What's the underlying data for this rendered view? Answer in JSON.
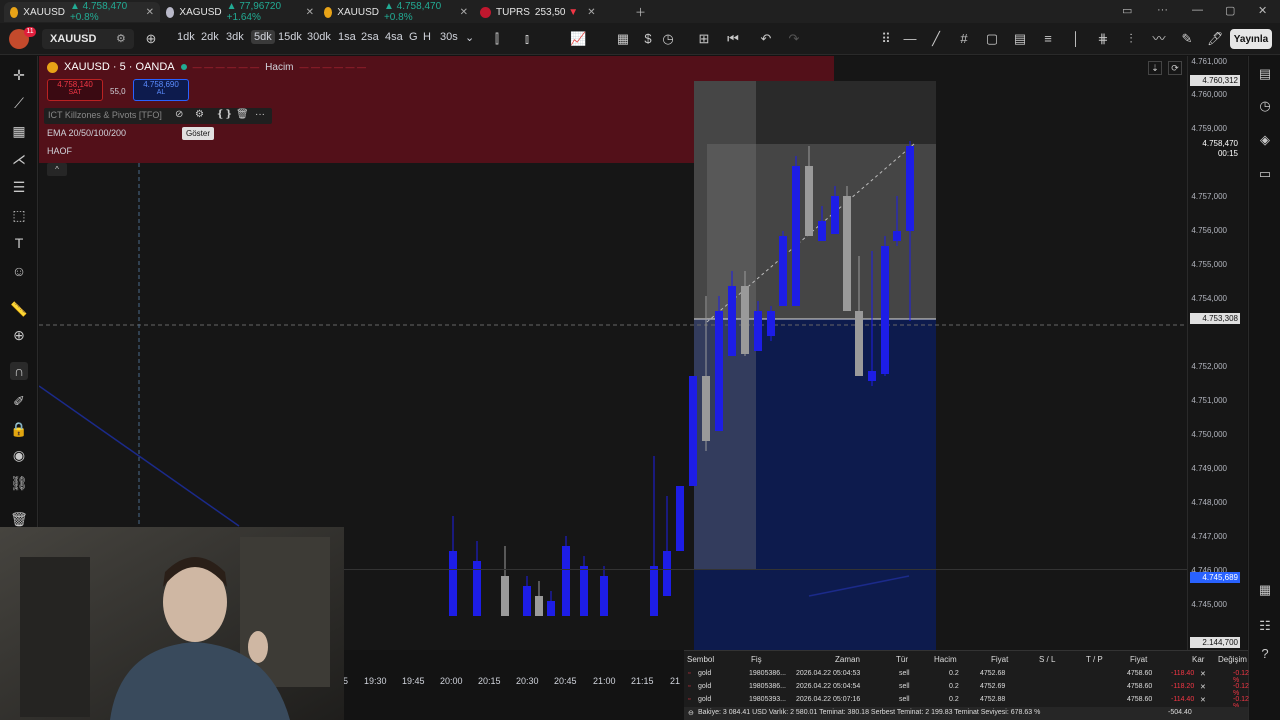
{
  "tabs": [
    {
      "title": "XAUUSD",
      "price": "4.758,470",
      "change": "+0.8%",
      "positive": true,
      "icon": "gold-coin-icon"
    },
    {
      "title": "XAGUSD",
      "price": "77,96720",
      "change": "+1.64%",
      "positive": true,
      "icon": "silver-coin-icon"
    },
    {
      "title": "XAUUSD",
      "price": "4.758,470",
      "change": "+0.8%",
      "positive": true,
      "icon": "gold-coin-icon"
    },
    {
      "title": "TUPRS",
      "price": "253,50",
      "change": "",
      "positive": false,
      "icon": "tupras-logo-icon"
    }
  ],
  "header": {
    "avatar_badge": "11",
    "symbol": "XAUUSD",
    "intervals": [
      "1dk",
      "2dk",
      "3dk",
      "5dk",
      "15dk",
      "30dk",
      "1sa",
      "2sa",
      "4sa",
      "G",
      "H",
      "30s"
    ],
    "selected_interval": "5dk",
    "publish_label": "Yayınla"
  },
  "legend": {
    "title": "XAUUSD · 5 · OANDA",
    "volume_label": "Hacim",
    "sell_price": "4.758,140",
    "sell_label": "SAT",
    "spread": "55,0",
    "buy_price": "4.758,690",
    "buy_label": "AL",
    "indicators": [
      "ICT Killzones & Pivots [TFO]",
      "EMA 20/50/100/200",
      "HAOF"
    ],
    "tooltip": "Göster"
  },
  "price_axis": {
    "ticks": [
      "4.761,000",
      "4.760,000",
      "4.759,000",
      "4.757,000",
      "4.756,000",
      "4.755,000",
      "4.754,000",
      "4.752,000",
      "4.751,000",
      "4.750,000",
      "4.749,000",
      "4.748,000",
      "4.747,000",
      "4.746,000",
      "4.745,000"
    ],
    "badge_high": "4.760,312",
    "badge_last": "4.758,470",
    "badge_timer": "00:15",
    "badge_cross": "4.753,308",
    "badge_low": "4.745,689",
    "badge_volume": "2.144,700"
  },
  "time_axis": {
    "labels": [
      "5",
      "19:30",
      "19:45",
      "20:00",
      "20:15",
      "20:30",
      "20:45",
      "21:00",
      "21:15",
      "21"
    ]
  },
  "trades": {
    "headers": [
      "Sembol",
      "Fiş",
      "Zaman",
      "Tür",
      "Hacim",
      "Fiyat",
      "S / L",
      "T / P",
      "Fiyat",
      "Kar",
      "Değişim"
    ],
    "rows": [
      {
        "symbol": "gold",
        "ticket": "19805386...",
        "time": "2026.04.22 05:04:53",
        "type": "sell",
        "volume": "0.2",
        "price": "4752.68",
        "cur": "4758.60",
        "profit": "-118.40",
        "change": "-0.12 %"
      },
      {
        "symbol": "gold",
        "ticket": "19805386...",
        "time": "2026.04.22 05:04:54",
        "type": "sell",
        "volume": "0.2",
        "price": "4752.69",
        "cur": "4758.60",
        "profit": "-118.20",
        "change": "-0.12 %"
      },
      {
        "symbol": "gold",
        "ticket": "19805393...",
        "time": "2026.04.22 05:07:16",
        "type": "sell",
        "volume": "0.2",
        "price": "4752.88",
        "cur": "4758.60",
        "profit": "-114.40",
        "change": "-0.12 %"
      }
    ],
    "footer": "Bakiye: 3 084.41 USD  Varlık: 2 580.01  Teminat: 380.18  Serbest Teminat: 2 199.83  Teminat Seviyesi: 678.63 %",
    "footer_total": "-504.40"
  },
  "colors": {
    "up_candle": "#1d1de6",
    "down_candle": "#9a9a9a",
    "red_zone": "#5a0f1a",
    "blue_zone": "#0d1b4d",
    "accent": "#2962ff"
  }
}
